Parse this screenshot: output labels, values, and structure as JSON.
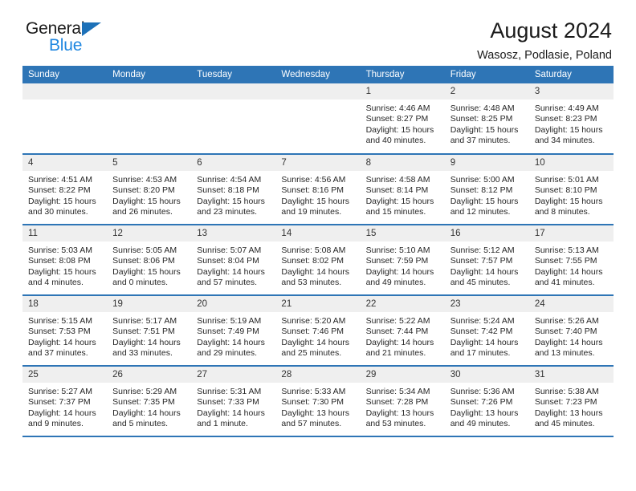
{
  "brand": {
    "name_part1": "General",
    "name_part2": "Blue",
    "accent_color": "#1f87e0",
    "triangle_color": "#1d71b8"
  },
  "header": {
    "title": "August 2024",
    "subtitle": "Wasosz, Podlasie, Poland",
    "header_bg_color": "#2e75b6"
  },
  "calendar": {
    "weekday_headers": [
      "Sunday",
      "Monday",
      "Tuesday",
      "Wednesday",
      "Thursday",
      "Friday",
      "Saturday"
    ],
    "weeks": [
      [
        {
          "day": "",
          "sunrise": "",
          "sunset": "",
          "daylight": ""
        },
        {
          "day": "",
          "sunrise": "",
          "sunset": "",
          "daylight": ""
        },
        {
          "day": "",
          "sunrise": "",
          "sunset": "",
          "daylight": ""
        },
        {
          "day": "",
          "sunrise": "",
          "sunset": "",
          "daylight": ""
        },
        {
          "day": "1",
          "sunrise": "Sunrise: 4:46 AM",
          "sunset": "Sunset: 8:27 PM",
          "daylight": "Daylight: 15 hours and 40 minutes."
        },
        {
          "day": "2",
          "sunrise": "Sunrise: 4:48 AM",
          "sunset": "Sunset: 8:25 PM",
          "daylight": "Daylight: 15 hours and 37 minutes."
        },
        {
          "day": "3",
          "sunrise": "Sunrise: 4:49 AM",
          "sunset": "Sunset: 8:23 PM",
          "daylight": "Daylight: 15 hours and 34 minutes."
        }
      ],
      [
        {
          "day": "4",
          "sunrise": "Sunrise: 4:51 AM",
          "sunset": "Sunset: 8:22 PM",
          "daylight": "Daylight: 15 hours and 30 minutes."
        },
        {
          "day": "5",
          "sunrise": "Sunrise: 4:53 AM",
          "sunset": "Sunset: 8:20 PM",
          "daylight": "Daylight: 15 hours and 26 minutes."
        },
        {
          "day": "6",
          "sunrise": "Sunrise: 4:54 AM",
          "sunset": "Sunset: 8:18 PM",
          "daylight": "Daylight: 15 hours and 23 minutes."
        },
        {
          "day": "7",
          "sunrise": "Sunrise: 4:56 AM",
          "sunset": "Sunset: 8:16 PM",
          "daylight": "Daylight: 15 hours and 19 minutes."
        },
        {
          "day": "8",
          "sunrise": "Sunrise: 4:58 AM",
          "sunset": "Sunset: 8:14 PM",
          "daylight": "Daylight: 15 hours and 15 minutes."
        },
        {
          "day": "9",
          "sunrise": "Sunrise: 5:00 AM",
          "sunset": "Sunset: 8:12 PM",
          "daylight": "Daylight: 15 hours and 12 minutes."
        },
        {
          "day": "10",
          "sunrise": "Sunrise: 5:01 AM",
          "sunset": "Sunset: 8:10 PM",
          "daylight": "Daylight: 15 hours and 8 minutes."
        }
      ],
      [
        {
          "day": "11",
          "sunrise": "Sunrise: 5:03 AM",
          "sunset": "Sunset: 8:08 PM",
          "daylight": "Daylight: 15 hours and 4 minutes."
        },
        {
          "day": "12",
          "sunrise": "Sunrise: 5:05 AM",
          "sunset": "Sunset: 8:06 PM",
          "daylight": "Daylight: 15 hours and 0 minutes."
        },
        {
          "day": "13",
          "sunrise": "Sunrise: 5:07 AM",
          "sunset": "Sunset: 8:04 PM",
          "daylight": "Daylight: 14 hours and 57 minutes."
        },
        {
          "day": "14",
          "sunrise": "Sunrise: 5:08 AM",
          "sunset": "Sunset: 8:02 PM",
          "daylight": "Daylight: 14 hours and 53 minutes."
        },
        {
          "day": "15",
          "sunrise": "Sunrise: 5:10 AM",
          "sunset": "Sunset: 7:59 PM",
          "daylight": "Daylight: 14 hours and 49 minutes."
        },
        {
          "day": "16",
          "sunrise": "Sunrise: 5:12 AM",
          "sunset": "Sunset: 7:57 PM",
          "daylight": "Daylight: 14 hours and 45 minutes."
        },
        {
          "day": "17",
          "sunrise": "Sunrise: 5:13 AM",
          "sunset": "Sunset: 7:55 PM",
          "daylight": "Daylight: 14 hours and 41 minutes."
        }
      ],
      [
        {
          "day": "18",
          "sunrise": "Sunrise: 5:15 AM",
          "sunset": "Sunset: 7:53 PM",
          "daylight": "Daylight: 14 hours and 37 minutes."
        },
        {
          "day": "19",
          "sunrise": "Sunrise: 5:17 AM",
          "sunset": "Sunset: 7:51 PM",
          "daylight": "Daylight: 14 hours and 33 minutes."
        },
        {
          "day": "20",
          "sunrise": "Sunrise: 5:19 AM",
          "sunset": "Sunset: 7:49 PM",
          "daylight": "Daylight: 14 hours and 29 minutes."
        },
        {
          "day": "21",
          "sunrise": "Sunrise: 5:20 AM",
          "sunset": "Sunset: 7:46 PM",
          "daylight": "Daylight: 14 hours and 25 minutes."
        },
        {
          "day": "22",
          "sunrise": "Sunrise: 5:22 AM",
          "sunset": "Sunset: 7:44 PM",
          "daylight": "Daylight: 14 hours and 21 minutes."
        },
        {
          "day": "23",
          "sunrise": "Sunrise: 5:24 AM",
          "sunset": "Sunset: 7:42 PM",
          "daylight": "Daylight: 14 hours and 17 minutes."
        },
        {
          "day": "24",
          "sunrise": "Sunrise: 5:26 AM",
          "sunset": "Sunset: 7:40 PM",
          "daylight": "Daylight: 14 hours and 13 minutes."
        }
      ],
      [
        {
          "day": "25",
          "sunrise": "Sunrise: 5:27 AM",
          "sunset": "Sunset: 7:37 PM",
          "daylight": "Daylight: 14 hours and 9 minutes."
        },
        {
          "day": "26",
          "sunrise": "Sunrise: 5:29 AM",
          "sunset": "Sunset: 7:35 PM",
          "daylight": "Daylight: 14 hours and 5 minutes."
        },
        {
          "day": "27",
          "sunrise": "Sunrise: 5:31 AM",
          "sunset": "Sunset: 7:33 PM",
          "daylight": "Daylight: 14 hours and 1 minute."
        },
        {
          "day": "28",
          "sunrise": "Sunrise: 5:33 AM",
          "sunset": "Sunset: 7:30 PM",
          "daylight": "Daylight: 13 hours and 57 minutes."
        },
        {
          "day": "29",
          "sunrise": "Sunrise: 5:34 AM",
          "sunset": "Sunset: 7:28 PM",
          "daylight": "Daylight: 13 hours and 53 minutes."
        },
        {
          "day": "30",
          "sunrise": "Sunrise: 5:36 AM",
          "sunset": "Sunset: 7:26 PM",
          "daylight": "Daylight: 13 hours and 49 minutes."
        },
        {
          "day": "31",
          "sunrise": "Sunrise: 5:38 AM",
          "sunset": "Sunset: 7:23 PM",
          "daylight": "Daylight: 13 hours and 45 minutes."
        }
      ]
    ]
  }
}
